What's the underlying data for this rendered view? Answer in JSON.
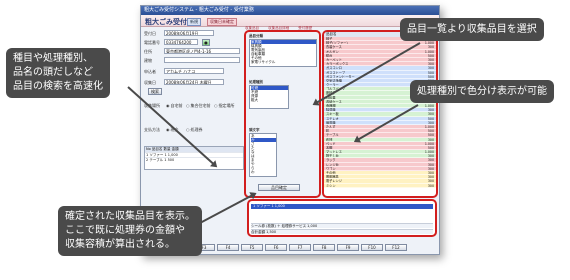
{
  "window": {
    "titlebar": "粗大ごみ受付システム - 粗大ごみ受付 - 受付業務",
    "app_title": "粗大ごみ受付",
    "mode_badge": "新規",
    "mode_badge2": "収集日未確定"
  },
  "left_form": {
    "reception_no_label": "受付番号",
    "reception_date_label": "受付日",
    "reception_date_value": "2008年06月19日",
    "phone_label": "電話番号",
    "phone_value": "0334764200",
    "address_label": "住所",
    "address_value": "東京都港区虎ノ門4-1-16",
    "building_label": "建物",
    "name_label": "申込者",
    "name_value": "アカムチ ハナコ",
    "search_button": "検索",
    "collection_date_label": "収集日",
    "collection_date_value": "2008年06月24日 木曜日",
    "collection_method_label": "収集場所",
    "radio_a": "自宅前",
    "radio_b": "集合住宅前",
    "radio_c": "指定場所",
    "payment_label": "支払方法",
    "pay_a": "現金",
    "pay_b": "処理券",
    "table_header": "No 品目名 数量 金額",
    "table_rows": [
      "1 ソファー 1 1,000",
      "2 テーブル 1 500"
    ]
  },
  "middle": {
    "tabs": [
      "収集品目",
      "収集品目詳細",
      "受付履歴"
    ],
    "category_title": "品目分類",
    "categories": [
      "家具類",
      "寝具類",
      "電気製品",
      "自転車類",
      "その他",
      "家電リサイクル"
    ],
    "type_title": "処理種別",
    "types": [
      "可燃",
      "不燃",
      "資源",
      "粗大"
    ],
    "initial_title": "頭文字",
    "initials": [
      "あ",
      "か",
      "さ",
      "た",
      "な",
      "は",
      "ま",
      "や",
      "ら",
      "わ"
    ],
    "confirm_button": "品目確定"
  },
  "right_list": {
    "header_name": "品目名",
    "header_price": "金額",
    "items": [
      {
        "name": "椅子",
        "price": "300",
        "color": "#f7c9cc"
      },
      {
        "name": "椅子(ソファー)",
        "price": "1,000",
        "color": "#f7c9cc"
      },
      {
        "name": "衣装ケース",
        "price": "300",
        "color": "#f7c9cc"
      },
      {
        "name": "オルガン",
        "price": "1,000",
        "color": "#f7c9cc"
      },
      {
        "name": "鏡台",
        "price": "500",
        "color": "#f7c9cc"
      },
      {
        "name": "カーペット",
        "price": "300",
        "color": "#f7c9cc"
      },
      {
        "name": "カラーボックス",
        "price": "300",
        "color": "#f7c9cc"
      },
      {
        "name": "ガスコンロ",
        "price": "300",
        "color": "#cfe0fb"
      },
      {
        "name": "ガスストーブ",
        "price": "500",
        "color": "#cfe0fb"
      },
      {
        "name": "ガスファンヒーター",
        "price": "500",
        "color": "#cfe0fb"
      },
      {
        "name": "空気清浄機",
        "price": "300",
        "color": "#cfe0fb"
      },
      {
        "name": "クーラー",
        "price": "1,000",
        "color": "#cfe0fb"
      },
      {
        "name": "ゴルフバッグ",
        "price": "300",
        "color": "#d6f2d3"
      },
      {
        "name": "座椅子",
        "price": "300",
        "color": "#d6f2d3"
      },
      {
        "name": "自転車",
        "price": "500",
        "color": "#d6f2d3"
      },
      {
        "name": "収納ケース",
        "price": "300",
        "color": "#d6f2d3"
      },
      {
        "name": "食器棚",
        "price": "1,000",
        "color": "#d6f2d3"
      },
      {
        "name": "除湿機",
        "price": "300",
        "color": "#cfe0fb"
      },
      {
        "name": "スキー板",
        "price": "300",
        "color": "#d6f2d3"
      },
      {
        "name": "ステレオ",
        "price": "500",
        "color": "#cfe0fb"
      },
      {
        "name": "扇風機",
        "price": "300",
        "color": "#cfe0fb"
      },
      {
        "name": "たんす",
        "price": "1,000",
        "color": "#f7c9cc"
      },
      {
        "name": "机",
        "price": "500",
        "color": "#f7c9cc"
      },
      {
        "name": "テーブル",
        "price": "500",
        "color": "#f7c9cc"
      },
      {
        "name": "布団",
        "price": "300",
        "color": "#d6f2d3"
      },
      {
        "name": "ベッド",
        "price": "1,000",
        "color": "#f7c9cc"
      },
      {
        "name": "本棚",
        "price": "500",
        "color": "#f7c9cc"
      },
      {
        "name": "マットレス",
        "price": "1,000",
        "color": "#d6f2d3"
      },
      {
        "name": "物干し台",
        "price": "300",
        "color": "#d6f2d3"
      },
      {
        "name": "ラック",
        "price": "300",
        "color": "#f7c9cc"
      },
      {
        "name": "レンジ台",
        "price": "300",
        "color": "#f7c9cc"
      },
      {
        "name": "ワゴン",
        "price": "300",
        "color": "#f7c9cc"
      },
      {
        "name": "その他",
        "price": "300",
        "color": "#fff2c2"
      },
      {
        "name": "照明器具",
        "price": "300",
        "color": "#fff2c2"
      },
      {
        "name": "電子レンジ",
        "price": "300",
        "color": "#fff2c2"
      },
      {
        "name": "ミシン",
        "price": "300",
        "color": "#fff2c2"
      }
    ],
    "confirm_button": "確定"
  },
  "bottom_area": {
    "selected_row": "1  ソファー  1  1,000",
    "sum_row_1": "シール券  (枚数)  ＋ 処理券サービス  1,000",
    "sum_row_2": "合計金額  1,500"
  },
  "footer_buttons": [
    "F1",
    "F2",
    "F3",
    "F4",
    "F5",
    "F6",
    "F7",
    "F8",
    "F9",
    "F10",
    "F12"
  ],
  "callouts": {
    "top_right": "品目一覧より収集品目を選択",
    "middle_right": "処理種別で色分け表示が可能",
    "left_line1": "種目や処理種別、",
    "left_line2": "品名の頭だしなど",
    "left_line3": "品目の検索を高速化",
    "bottom_line1": "確定された収集品目を表示。",
    "bottom_line2": "ここで既に処理券の金額や",
    "bottom_line3": "収集容積が算出される。"
  }
}
